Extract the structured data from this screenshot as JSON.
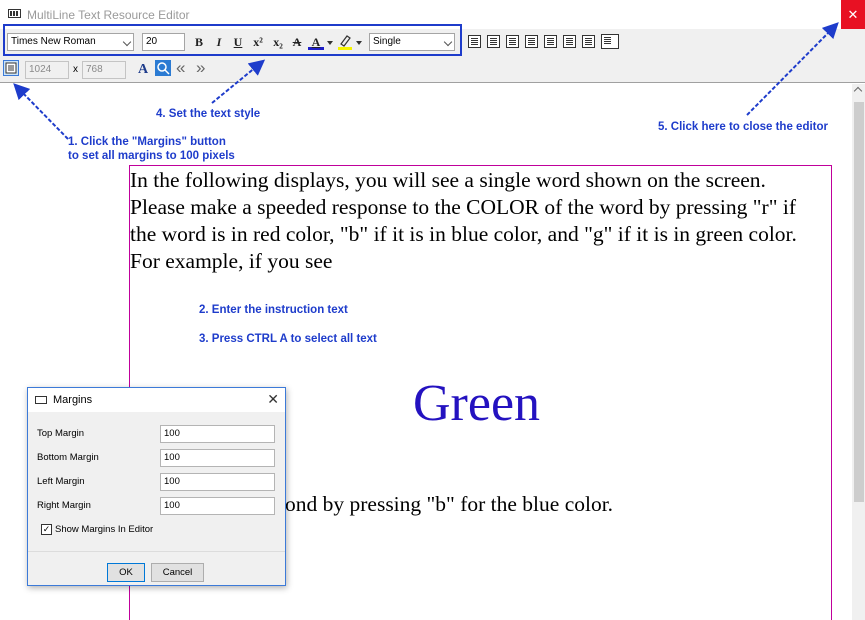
{
  "window": {
    "title": "MultiLine Text Resource Editor",
    "close_symbol": "✕"
  },
  "toolbar": {
    "font_name": "Times New Roman",
    "font_size": "20",
    "bold": "B",
    "italic": "I",
    "underline": "U",
    "superscript": "x²",
    "subscript": "x₂",
    "strikethrough": "A",
    "font_color": "A",
    "line_spacing": "Single"
  },
  "toolbar2": {
    "width": "1024",
    "times": "x",
    "height": "768",
    "prev": "«",
    "next": "»"
  },
  "colors": {
    "accent_blue": "#1e3ccb",
    "close_red": "#e81123",
    "margin_frame": "#c0009b",
    "green_word_color": "#2412c0"
  },
  "editor": {
    "instruction": "In the following displays, you will see a single word shown on the screen. Please make a speeded response to the COLOR of the word by pressing \"r\" if the word is in red color, \"b\" if it is in blue color, and \"g\" if it is in green color.  For example, if you see",
    "example_word": "Green",
    "tail_text": "ond by pressing \"b\" for the blue color."
  },
  "annotations": {
    "step1_line1": "1. Click the \"Margins\" button",
    "step1_line2": "to set all margins to 100 pixels",
    "step2": "2. Enter the instruction text",
    "step3": "3. Press CTRL A to select all text",
    "step4": "4. Set the text style",
    "step5": "5. Click here to close the editor"
  },
  "margins_dialog": {
    "title": "Margins",
    "close_symbol": "✕",
    "top_label": "Top Margin",
    "top_value": "100",
    "bottom_label": "Bottom Margin",
    "bottom_value": "100",
    "left_label": "Left Margin",
    "left_value": "100",
    "right_label": "Right Margin",
    "right_value": "100",
    "show_margins_label": "Show Margins In Editor",
    "show_margins_checked": "✓",
    "ok_label": "OK",
    "cancel_label": "Cancel"
  }
}
